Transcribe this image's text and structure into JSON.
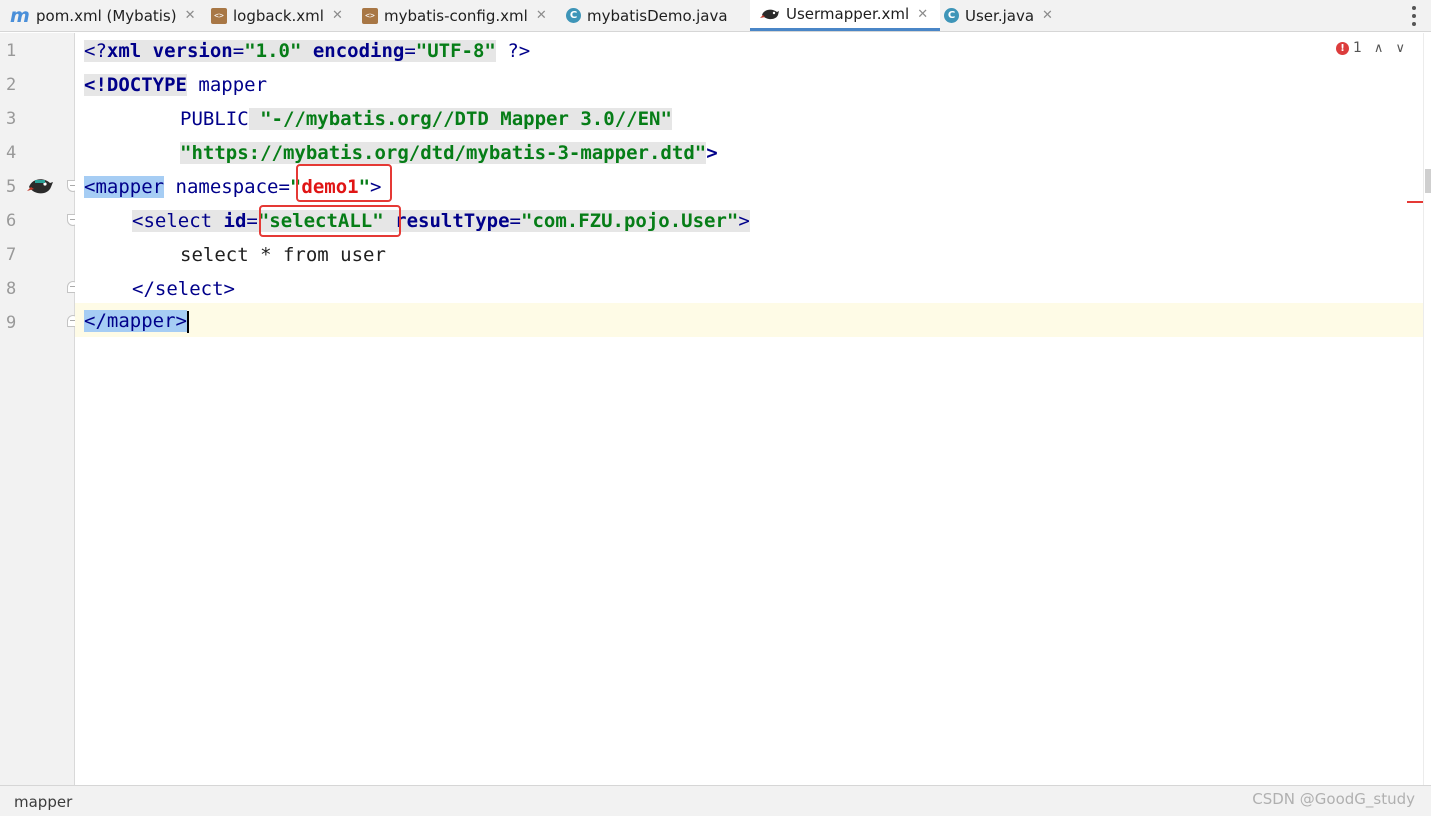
{
  "tabs": [
    {
      "label": "pom.xml (Mybatis)",
      "icon": "maven-icon",
      "active": false
    },
    {
      "label": "logback.xml",
      "icon": "xml-file-icon",
      "active": false
    },
    {
      "label": "mybatis-config.xml",
      "icon": "xml-file-icon",
      "active": false
    },
    {
      "label": "mybatisDemo.java",
      "icon": "java-class-icon",
      "active": false
    },
    {
      "label": "Usermapper.xml",
      "icon": "mybatis-icon",
      "active": true
    },
    {
      "label": "User.java",
      "icon": "java-class-icon",
      "active": false
    }
  ],
  "icon_glyphs": {
    "maven": "m",
    "xml": "<>",
    "class": "C",
    "close": "✕",
    "bulb": "💡"
  },
  "line_numbers": [
    "1",
    "2",
    "3",
    "4",
    "5",
    "6",
    "7",
    "8",
    "9"
  ],
  "code": {
    "l1": {
      "open": "<?",
      "tag": "xml",
      "a1": " version",
      "eq": "=",
      "v1": "\"1.0\"",
      "a2": " encoding",
      "v2": "\"UTF-8\"",
      "close": " ?>"
    },
    "l2": {
      "doctype": "<!DOCTYPE",
      "name": " mapper"
    },
    "l3": {
      "public": "PUBLIC",
      "id": " \"-//mybatis.org//DTD Mapper 3.0//EN\""
    },
    "l4": {
      "url": "\"https://mybatis.org/dtd/mybatis-3-mapper.dtd\"",
      "close": ">"
    },
    "l5": {
      "open": "<mapper",
      "attr": " namespace",
      "eq": "=",
      "q1": "\"",
      "value": "demo1",
      "q2": "\"",
      "close": ">"
    },
    "l6": {
      "open": "<select",
      "a1": " id",
      "eq": "=",
      "v1": "\"selectALL\"",
      "a2": " resultType",
      "v2": "\"com.FZU.pojo.User\"",
      "close": ">"
    },
    "l7": {
      "text": "select * from user"
    },
    "l8": {
      "text": "</select>"
    },
    "l9": {
      "text": "</mapper>"
    }
  },
  "inspection": {
    "errors": "1",
    "error_glyph": "!",
    "up": "∧",
    "down": "∨"
  },
  "status": {
    "breadcrumb": "mapper",
    "watermark": "CSDN @GoodG_study"
  },
  "colors": {
    "accent": "#4a86c7",
    "tag": "#00008a",
    "string": "#067d17",
    "error": "#e53935",
    "selection": "#a6cdf4"
  }
}
